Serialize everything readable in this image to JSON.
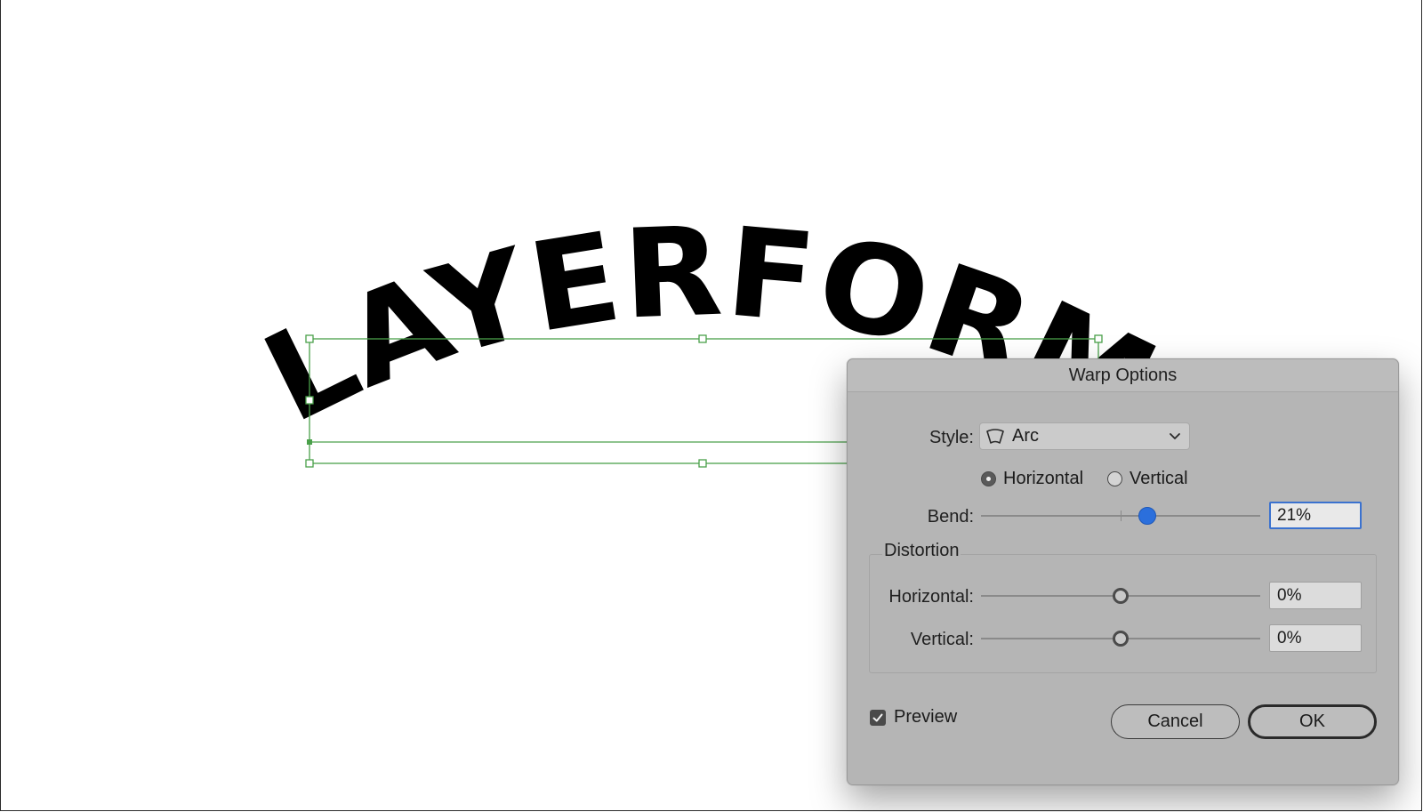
{
  "canvas": {
    "art_text": "LAYERFORM"
  },
  "dialog": {
    "title": "Warp Options",
    "style": {
      "label": "Style:",
      "selected": "Arc",
      "icon": "arc-warp-icon"
    },
    "orientation": {
      "horizontal_label": "Horizontal",
      "vertical_label": "Vertical",
      "selected": "Horizontal"
    },
    "bend": {
      "label": "Bend:",
      "value": "21%",
      "level_percent": 21
    },
    "distortion": {
      "group_title": "Distortion",
      "horizontal": {
        "label": "Horizontal:",
        "value": "0%",
        "level_percent": 0
      },
      "vertical": {
        "label": "Vertical:",
        "value": "0%",
        "level_percent": 0
      }
    },
    "preview": {
      "label": "Preview",
      "checked": true
    },
    "buttons": {
      "cancel": "Cancel",
      "ok": "OK"
    }
  },
  "colors": {
    "dialog_bg": "#b5b5b5",
    "accent_blue": "#2b6fdc",
    "selection_green": "#4aa04a"
  }
}
